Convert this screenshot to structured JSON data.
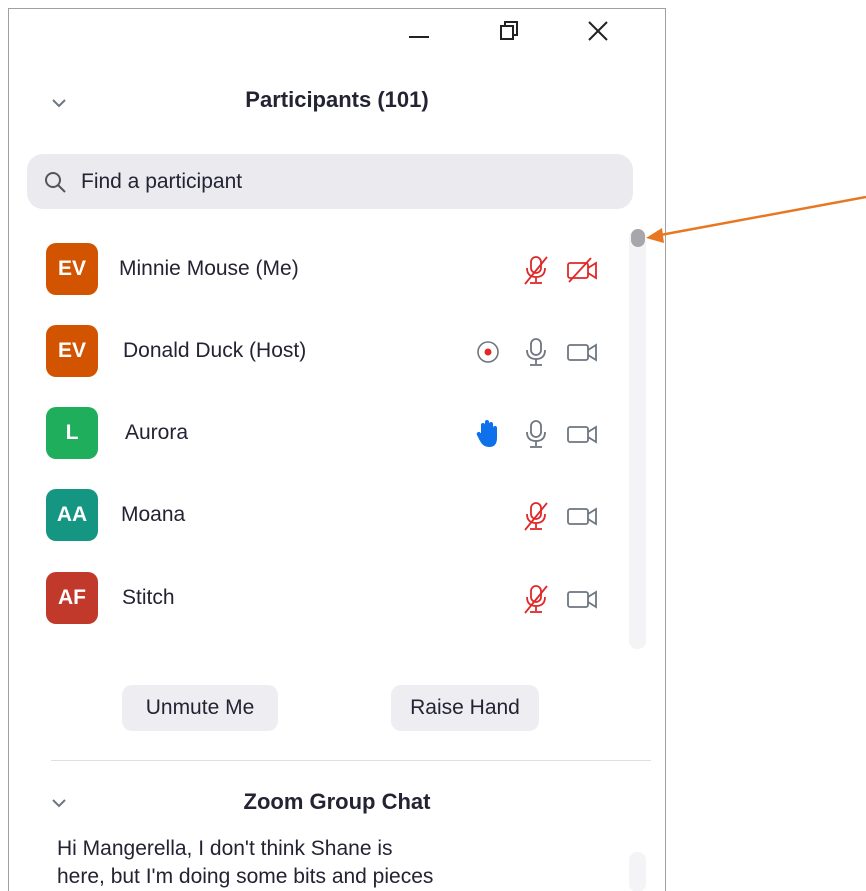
{
  "window": {
    "controls": {
      "minimize_icon": "minimize-icon",
      "maximize_icon": "restore-icon",
      "close_icon": "close-icon"
    }
  },
  "participants": {
    "title": "Participants (101)",
    "search": {
      "placeholder": "Find a participant",
      "value": ""
    },
    "list": [
      {
        "initials": "EV",
        "name": "Minnie Mouse (Me)",
        "avatar_color": "#d35400",
        "mic": "muted",
        "video": "off"
      },
      {
        "initials": "EV",
        "name": "Donald Duck (Host)",
        "avatar_color": "#d35400",
        "recording": true,
        "mic": "on",
        "video": "on"
      },
      {
        "initials": "L",
        "name": "Aurora",
        "avatar_color": "#1fae5b",
        "hand_raised": true,
        "mic": "on",
        "video": "on"
      },
      {
        "initials": "AA",
        "name": "Moana",
        "avatar_color": "#149683",
        "mic": "muted",
        "video": "on"
      },
      {
        "initials": "AF",
        "name": "Stitch",
        "avatar_color": "#c0392b",
        "mic": "muted",
        "video": "on"
      }
    ],
    "buttons": {
      "unmute": "Unmute Me",
      "raise_hand": "Raise Hand"
    }
  },
  "chat": {
    "title": "Zoom Group Chat",
    "preview_lines": [
      "Hi Mangerella, I don't think Shane is",
      "here, but I'm doing some bits and pieces"
    ]
  },
  "colors": {
    "muted_red": "#e02828",
    "hand_blue": "#0e71eb",
    "annotation_arrow": "#e87722"
  }
}
